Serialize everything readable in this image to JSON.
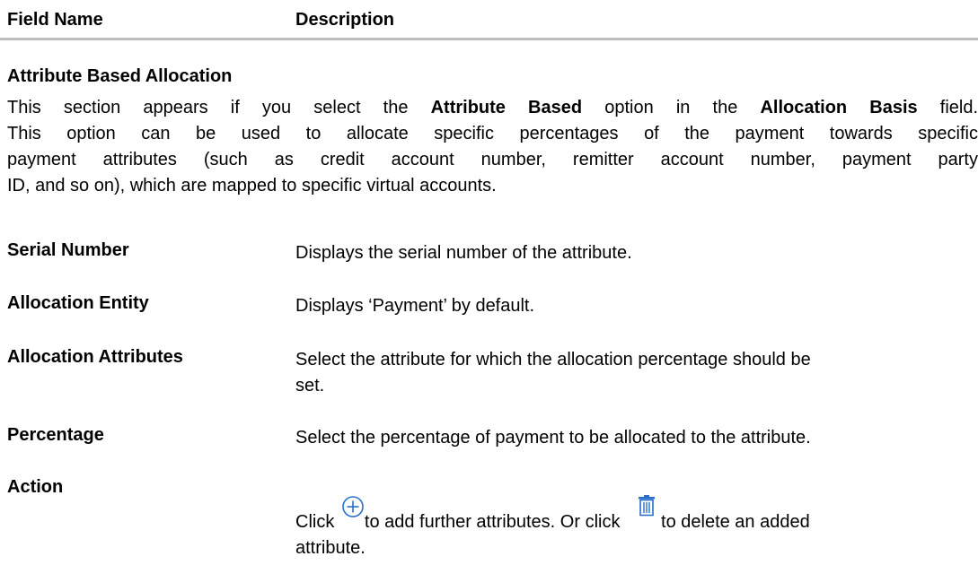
{
  "table": {
    "header": {
      "field_name": "Field Name",
      "description": "Description"
    }
  },
  "section": {
    "title": "Attribute Based Allocation",
    "para_line1_a": "This section appears if you select the ",
    "para_line1_b": "Attribute Based",
    "para_line1_c": " option in the ",
    "para_line1_d": "Allocation Basis",
    "para_line1_e": " field.",
    "para_line2": "This option can be used to allocate specific percentages of the payment towards specific",
    "para_line3": "payment attributes (such as credit account number, remitter account number, payment party",
    "para_line4": "ID, and so on), which are mapped to specific virtual accounts."
  },
  "rows": {
    "serial_number": {
      "field": "Serial Number",
      "desc": "Displays the serial number of the attribute."
    },
    "allocation_entity": {
      "field": "Allocation Entity",
      "desc": "Displays ‘Payment’ by default."
    },
    "allocation_attributes": {
      "field": "Allocation Attributes",
      "desc_line1": "Select the attribute for which the allocation percentage should be",
      "desc_line2": "set."
    },
    "percentage": {
      "field": "Percentage",
      "desc": "Select the percentage of payment to be allocated to the attribute."
    },
    "action": {
      "field": "Action",
      "desc_a": "Click ",
      "desc_b": "to add further attributes. Or click ",
      "desc_c": "to delete an added",
      "desc_line2": "attribute."
    }
  },
  "icons": {
    "add": "add-circle-icon",
    "delete": "trash-icon",
    "icon_color": "#2a6fc9"
  }
}
